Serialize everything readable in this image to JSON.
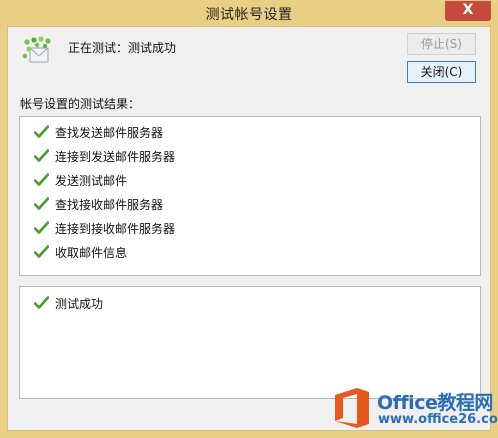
{
  "window": {
    "title": "测试帐号设置",
    "close_glyph": "X"
  },
  "status": {
    "text": "正在测试：测试成功"
  },
  "buttons": {
    "stop": "停止(S)",
    "close": "关闭(C)"
  },
  "results": {
    "label": "帐号设置的测试结果：",
    "items": [
      "查找发送邮件服务器",
      "连接到发送邮件服务器",
      "发送测试邮件",
      "查找接收邮件服务器",
      "连接到接收邮件服务器",
      "收取邮件信息"
    ]
  },
  "summary": {
    "items": [
      "测试成功"
    ]
  },
  "watermark": {
    "brand": "Office教程网",
    "url": "www.office26.com"
  },
  "icons": {
    "status": "check-icon",
    "app": "account-test-icon",
    "logo": "office-logo-icon"
  },
  "colors": {
    "check": "#4a9a2c",
    "titlebar": "#e9cf83",
    "close": "#c7483d",
    "brand": "#2a6fb5",
    "logo_orange": "#e8591f"
  }
}
